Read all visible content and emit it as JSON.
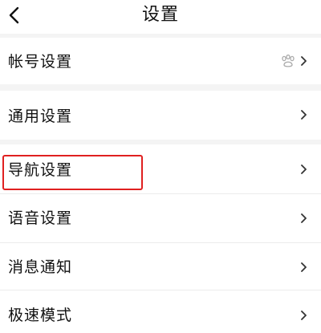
{
  "header": {
    "title": "设置",
    "back_icon": "chevron-left-icon"
  },
  "settings": {
    "items": [
      {
        "label": "帐号设置",
        "trailing_icon": "baidu-paw-icon"
      },
      {
        "label": "通用设置"
      },
      {
        "label": "导航设置",
        "highlighted": true
      },
      {
        "label": "语音设置"
      },
      {
        "label": "消息通知"
      },
      {
        "label": "极速模式"
      }
    ]
  },
  "colors": {
    "page_background": "#f4f4f4",
    "row_background": "#ffffff",
    "highlight": "#e02020",
    "text": "#111111",
    "chevron": "#333333"
  }
}
